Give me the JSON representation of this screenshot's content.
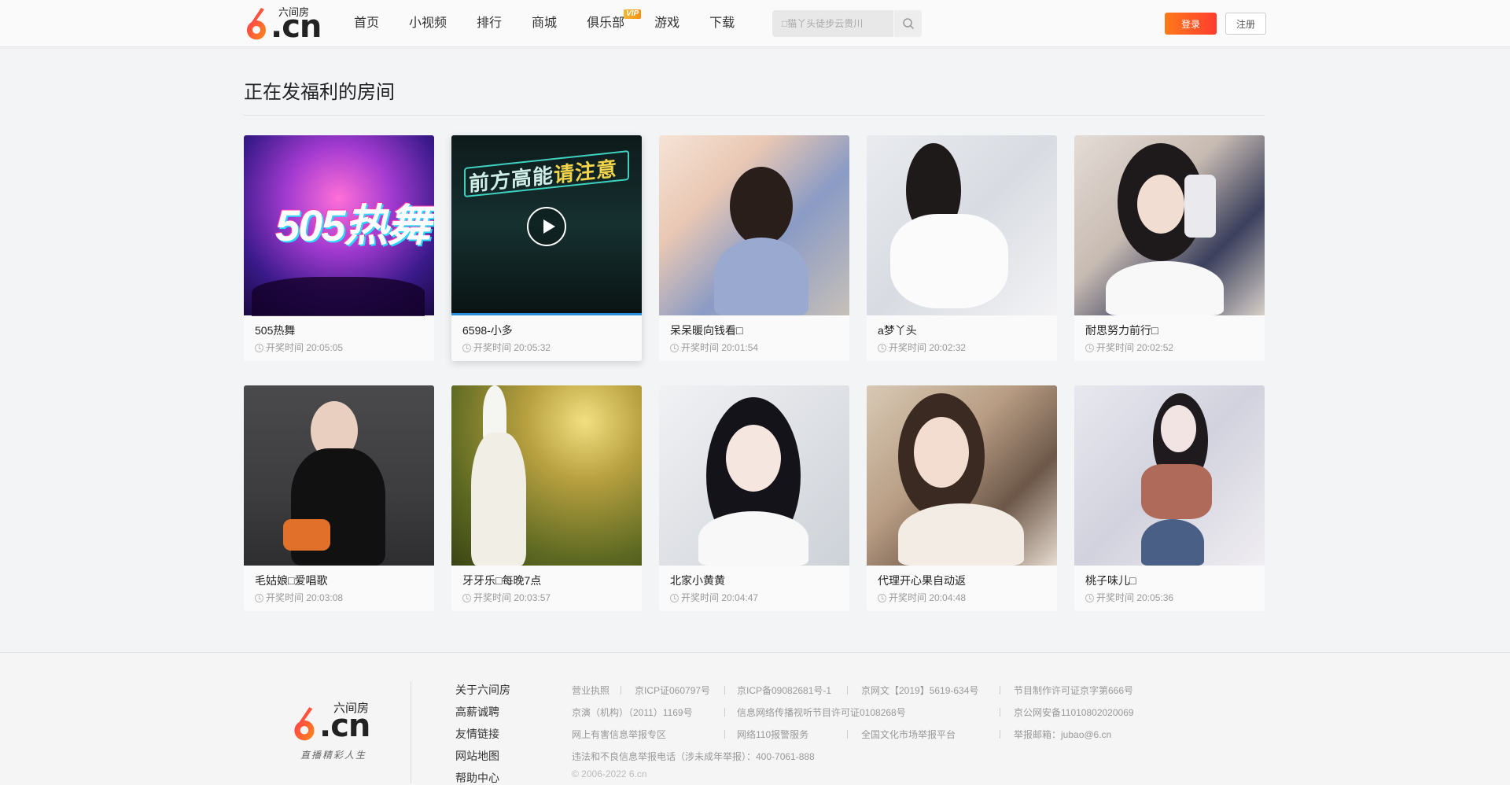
{
  "header": {
    "logo_small": "六间房",
    "logo_cn": ".cn",
    "nav": [
      "首页",
      "小视频",
      "排行",
      "商城",
      "俱乐部",
      "游戏",
      "下载"
    ],
    "vip_badge": "VIP",
    "search_placeholder": "□猫丫头徒步云贵川",
    "login_label": "登录",
    "register_label": "注册"
  },
  "main": {
    "title": "正在发福利的房间",
    "rooms": [
      {
        "name": "505热舞",
        "time": "开奖时间 20:05:05"
      },
      {
        "name": "6598-小多",
        "time": "开奖时间 20:05:32"
      },
      {
        "name": "呆呆暖向钱看□",
        "time": "开奖时间 20:01:54"
      },
      {
        "name": "a梦丫头",
        "time": "开奖时间 20:02:32"
      },
      {
        "name": "耐思努力前行□",
        "time": "开奖时间 20:02:52"
      },
      {
        "name": "毛姑娘□爱唱歌",
        "time": "开奖时间 20:03:08"
      },
      {
        "name": "牙牙乐□每晚7点",
        "time": "开奖时间 20:03:57"
      },
      {
        "name": "北家小黄黄",
        "time": "开奖时间 20:04:47"
      },
      {
        "name": "代理开心果自动返",
        "time": "开奖时间 20:04:48"
      },
      {
        "name": "桃子味儿□",
        "time": "开奖时间 20:05:36"
      }
    ],
    "thumb_text_1": "505热舞",
    "thumb_text_2a": "前方高能",
    "thumb_text_2b": "请注意"
  },
  "footer": {
    "logo_small": "六间房",
    "logo_cn": ".cn",
    "slogan": "直播精彩人生",
    "links": [
      "关于六间房",
      "高薪诚聘",
      "友情链接",
      "网站地图",
      "帮助中心"
    ],
    "info": {
      "r1": [
        "营业执照",
        "京ICP证060797号",
        "京ICP备09082681号-1",
        "京网文【2019】5619-634号",
        "节目制作许可证京字第666号"
      ],
      "r2": [
        "京演（机构）（2011）1169号",
        "信息网络传播视听节目许可证0108268号",
        "京公网安备11010802020069"
      ],
      "r3": [
        "网上有害信息举报专区",
        "网络110报警服务",
        "全国文化市场举报平台",
        "举报邮箱：jubao@6.cn"
      ],
      "r4": "违法和不良信息举报电话（涉未成年举报）：400-7061-888",
      "r5": "© 2006-2022 6.cn"
    }
  },
  "colors": {
    "accent": "#ff5a2a",
    "active_bar": "#2b8fd8",
    "vip": "#f29111"
  }
}
